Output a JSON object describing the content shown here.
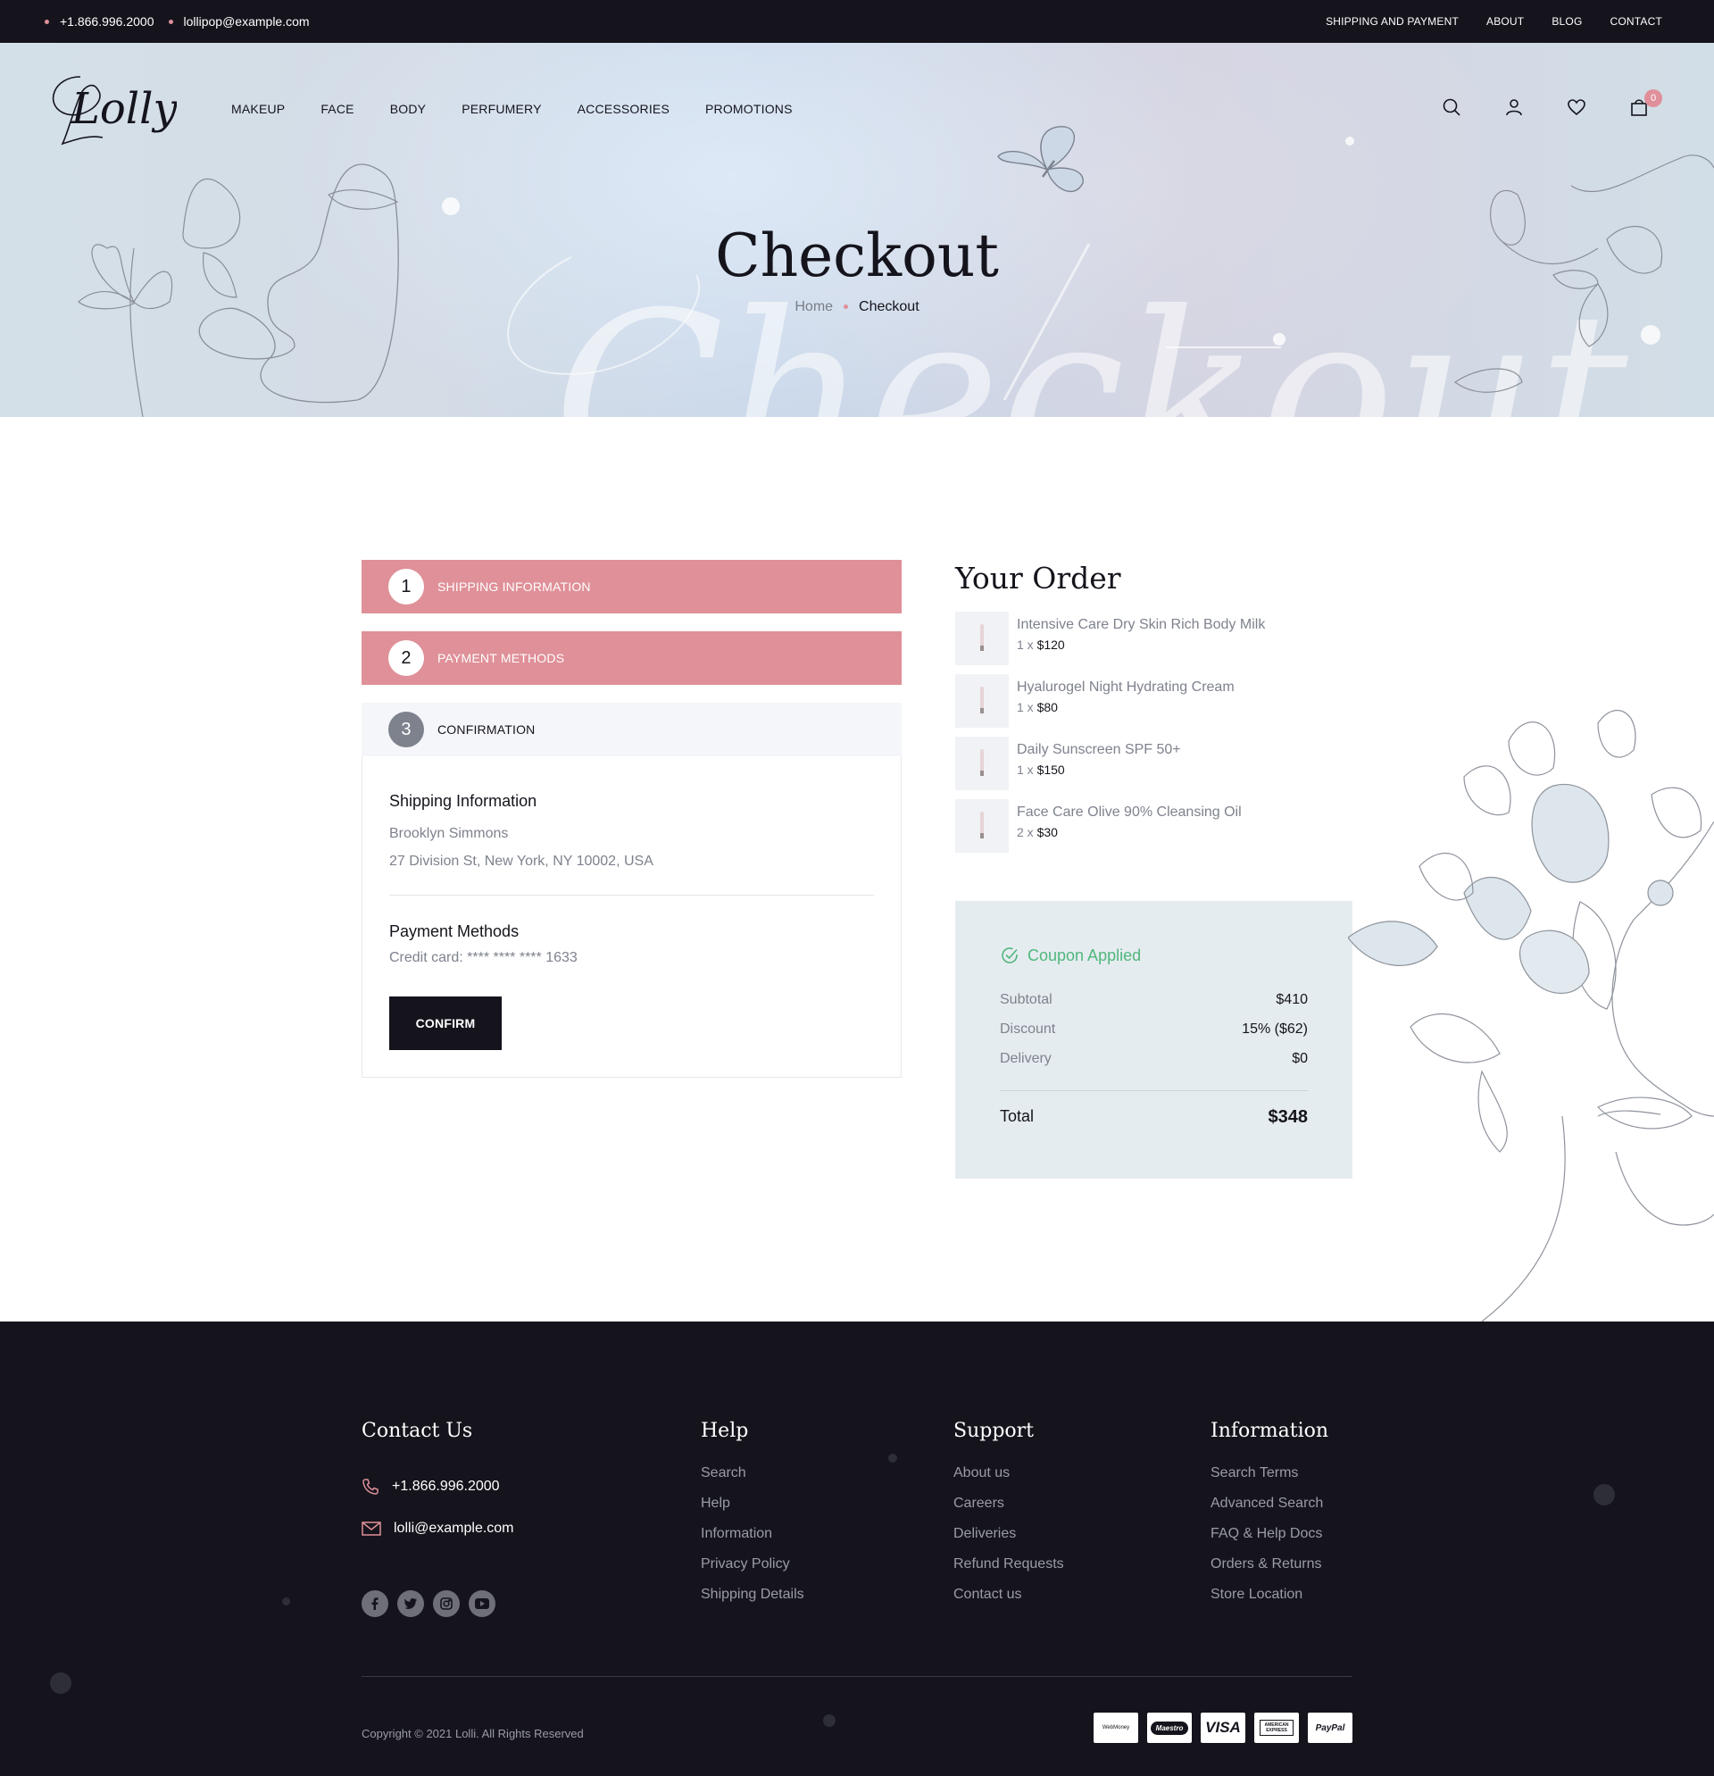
{
  "topbar": {
    "phone": "+1.866.996.2000",
    "email": "lollipop@example.com",
    "links": [
      "SHIPPING AND PAYMENT",
      "ABOUT",
      "BLOG",
      "CONTACT"
    ]
  },
  "header": {
    "logo_text": "Lolly",
    "nav": [
      "MAKEUP",
      "FACE",
      "BODY",
      "PERFUMERY",
      "ACCESSORIES",
      "PROMOTIONS"
    ],
    "cart_count": "0",
    "icons": [
      "search-icon",
      "user-icon",
      "heart-icon",
      "cart-icon"
    ]
  },
  "hero": {
    "title": "Checkout",
    "watermark": "Checkout",
    "breadcrumb_home": "Home",
    "breadcrumb_current": "Checkout"
  },
  "steps": [
    {
      "num": "1",
      "label": "SHIPPING INFORMATION"
    },
    {
      "num": "2",
      "label": "PAYMENT METHODS"
    },
    {
      "num": "3",
      "label": "CONFIRMATION"
    }
  ],
  "confirmation": {
    "shipping_title": "Shipping Information",
    "shipping_name": "Brooklyn Simmons",
    "shipping_address": "27 Division St, New York, NY 10002, USA",
    "payment_title": "Payment Methods",
    "payment_line": "Credit card: **** **** **** 1633",
    "confirm_label": "CONFIRM"
  },
  "order": {
    "title": "Your Order",
    "items": [
      {
        "name": "Intensive Care Dry Skin Rich Body Milk",
        "qty": "1 x",
        "price": "$120"
      },
      {
        "name": "Hyalurogel Night Hydrating Cream",
        "qty": "1 x",
        "price": "$80"
      },
      {
        "name": "Daily Sunscreen SPF 50+",
        "qty": "1 x",
        "price": "$150"
      },
      {
        "name": "Face Care Olive 90% Cleansing Oil",
        "qty": "2 x",
        "price": "$30"
      }
    ],
    "coupon": "Coupon Applied",
    "rows": [
      {
        "label": "Subtotal",
        "value": "$410"
      },
      {
        "label": "Discount",
        "value": "15% ($62)"
      },
      {
        "label": "Delivery",
        "value": "$0"
      }
    ],
    "total_label": "Total",
    "total_value": "$348"
  },
  "footer": {
    "contact_title": "Contact Us",
    "phone": "+1.866.996.2000",
    "email": "lolli@example.com",
    "help_title": "Help",
    "help": [
      "Search",
      "Help",
      "Information",
      "Privacy Policy",
      "Shipping Details"
    ],
    "support_title": "Support",
    "support": [
      "About us",
      "Careers",
      "Deliveries",
      "Refund Requests",
      "Contact us"
    ],
    "info_title": "Information",
    "info": [
      "Search Terms",
      "Advanced Search",
      "FAQ & Help Docs",
      "Orders & Returns",
      "Store Location"
    ],
    "copyright": "Copyright © 2021 Lolli.  All Rights Reserved",
    "payments": [
      "WebMoney",
      "Maestro",
      "VISA",
      "AMERICAN EXPRESS",
      "PayPal"
    ]
  },
  "colors": {
    "accent": "#df9098",
    "dark": "#15141c",
    "muted": "#7e828d",
    "coupon": "#4fb77c",
    "summary_bg": "#e5ecf0"
  }
}
